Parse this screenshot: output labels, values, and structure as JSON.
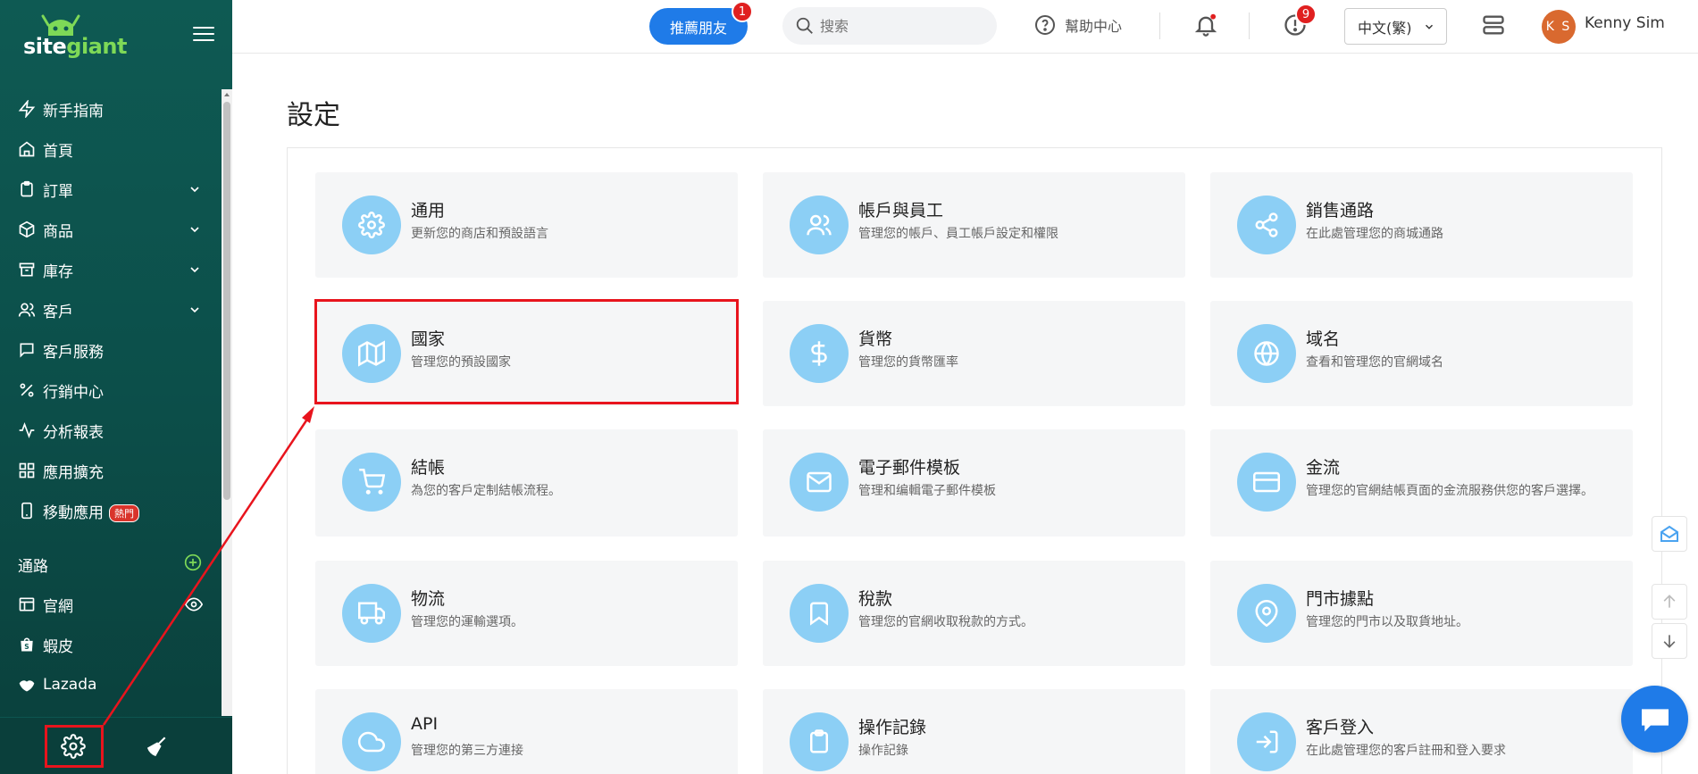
{
  "brand": {
    "logo_text_a": "site",
    "logo_text_b": "giant"
  },
  "sidebar": {
    "items": [
      {
        "label": "新手指南",
        "icon": "bolt-icon"
      },
      {
        "label": "首頁",
        "icon": "home-icon"
      },
      {
        "label": "訂單",
        "icon": "clipboard-icon",
        "expandable": true
      },
      {
        "label": "商品",
        "icon": "box-icon",
        "expandable": true
      },
      {
        "label": "庫存",
        "icon": "archive-icon",
        "expandable": true
      },
      {
        "label": "客戶",
        "icon": "users-icon",
        "expandable": true
      },
      {
        "label": "客戶服務",
        "icon": "chat-icon"
      },
      {
        "label": "行銷中心",
        "icon": "percent-icon"
      },
      {
        "label": "分析報表",
        "icon": "activity-icon"
      },
      {
        "label": "應用擴充",
        "icon": "grid-icon"
      },
      {
        "label": "移動應用",
        "icon": "phone-icon",
        "badge": "熱門"
      }
    ],
    "channels_title": "通路",
    "channels": [
      {
        "label": "官網",
        "icon": "store-icon"
      },
      {
        "label": "蝦皮",
        "icon": "shopee-icon"
      },
      {
        "label": "Lazada",
        "icon": "lazada-icon"
      }
    ]
  },
  "topbar": {
    "refer_label": "推薦朋友",
    "refer_badge": "1",
    "search_placeholder": "搜索",
    "help_label": "幫助中心",
    "alert_badge": "9",
    "language": "中文(繁)",
    "user_initials": "K S",
    "user_name": "Kenny Sim"
  },
  "page": {
    "title": "設定"
  },
  "settings": [
    {
      "title": "通用",
      "desc": "更新您的商店和預設語言",
      "icon": "gear-icon"
    },
    {
      "title": "帳戶與員工",
      "desc": "管理您的帳戶、員工帳戶設定和權限",
      "icon": "users-icon"
    },
    {
      "title": "銷售通路",
      "desc": "在此處管理您的商城通路",
      "icon": "share-icon"
    },
    {
      "title": "國家",
      "desc": "管理您的預設國家",
      "icon": "map-icon"
    },
    {
      "title": "貨幣",
      "desc": "管理您的貨幣匯率",
      "icon": "dollar-icon"
    },
    {
      "title": "域名",
      "desc": "查看和管理您的官網域名",
      "icon": "globe-icon"
    },
    {
      "title": "結帳",
      "desc": "為您的客戶定制結帳流程。",
      "icon": "cart-icon"
    },
    {
      "title": "電子郵件模板",
      "desc": "管理和编輯電子郵件模板",
      "icon": "mail-icon"
    },
    {
      "title": "金流",
      "desc": "管理您的官網結帳頁面的金流服務供您的客戶選擇。",
      "icon": "credit-card-icon"
    },
    {
      "title": "物流",
      "desc": "管理您的運輸選項。",
      "icon": "truck-icon"
    },
    {
      "title": "稅款",
      "desc": "管理您的官網收取稅款的方式。",
      "icon": "bookmark-icon"
    },
    {
      "title": "門市據點",
      "desc": "管理您的門市以及取貨地址。",
      "icon": "pin-icon"
    },
    {
      "title": "API",
      "desc": "管理您的第三方連接",
      "icon": "cloud-icon"
    },
    {
      "title": "操作記錄",
      "desc": "操作記錄",
      "icon": "clipboard-icon"
    },
    {
      "title": "客戶登入",
      "desc": "在此處管理您的客戶註冊和登入要求",
      "icon": "login-icon"
    }
  ],
  "colors": {
    "accent": "#1f7be8",
    "sidebar": "#0e5a53",
    "icon_circle": "#8ccff5",
    "highlight": "#e8141d"
  }
}
